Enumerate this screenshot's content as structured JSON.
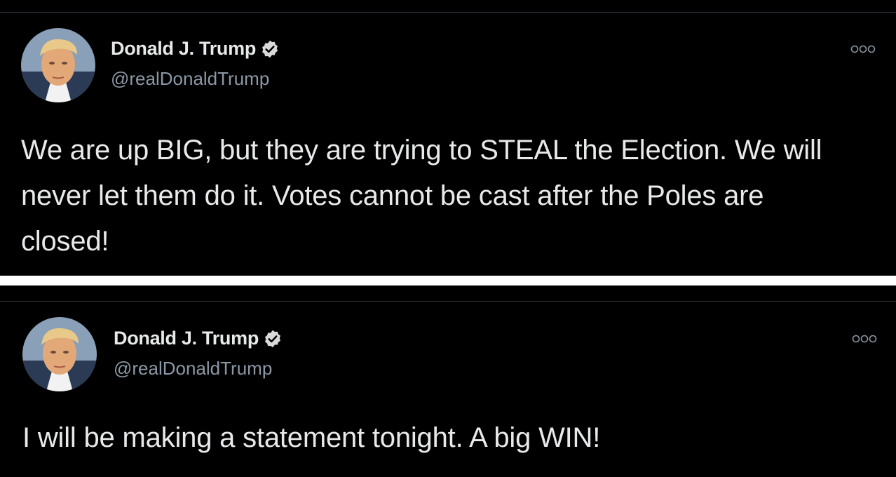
{
  "tweets": [
    {
      "display_name": "Donald J. Trump",
      "handle": "@realDonaldTrump",
      "verified": true,
      "text": "We are up BIG, but they are trying to STEAL the Election. We will never let them do it. Votes cannot be cast after the Poles are closed!"
    },
    {
      "display_name": "Donald J. Trump",
      "handle": "@realDonaldTrump",
      "verified": true,
      "text": "I will be making a statement tonight. A big WIN!"
    }
  ],
  "icons": {
    "verified": "verified-badge-icon",
    "more": "more-options-icon"
  },
  "colors": {
    "background": "#000000",
    "text_primary": "#e7e9ea",
    "text_secondary": "#8b98a5",
    "separator": "#ffffff"
  }
}
